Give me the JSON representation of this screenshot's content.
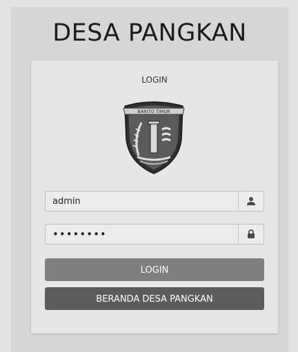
{
  "site_title": "DESA PANGKAN",
  "login_card": {
    "title": "LOGIN",
    "emblem_banner": "BARITO TIMUR",
    "username_value": "admin",
    "password_value": "••••••••",
    "login_button": "LOGIN",
    "home_button": "BERANDA DESA PANGKAN"
  },
  "icons": {
    "username": "user-icon",
    "password": "lock-icon"
  },
  "colors": {
    "login_button": "#7f7f7f",
    "home_button": "#5c5c5c"
  }
}
